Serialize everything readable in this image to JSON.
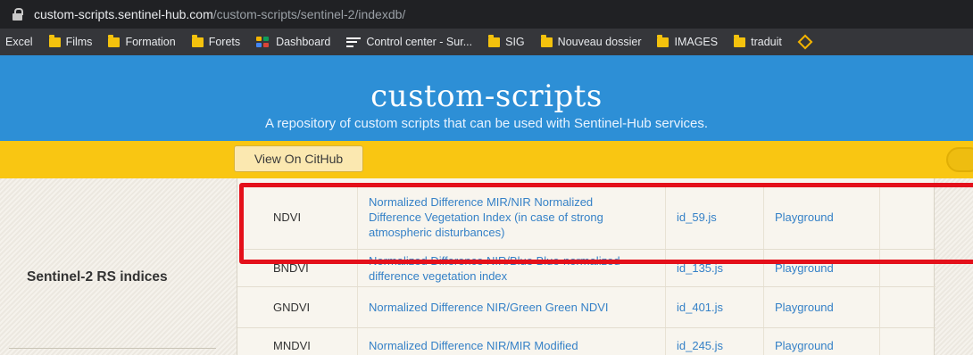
{
  "browser": {
    "url_host": "custom-scripts.sentinel-hub.com",
    "url_path": "/custom-scripts/sentinel-2/indexdb/",
    "bookmarks": [
      {
        "label": "Excel",
        "icon": "none"
      },
      {
        "label": "Films",
        "icon": "folder-icon"
      },
      {
        "label": "Formation",
        "icon": "folder-icon"
      },
      {
        "label": "Forets",
        "icon": "folder-icon"
      },
      {
        "label": "Dashboard",
        "icon": "dashboard-icon"
      },
      {
        "label": "Control center - Sur...",
        "icon": "control-center-icon"
      },
      {
        "label": "SIG",
        "icon": "folder-icon"
      },
      {
        "label": "Nouveau dossier",
        "icon": "folder-icon"
      },
      {
        "label": "IMAGES",
        "icon": "folder-icon"
      },
      {
        "label": "traduit",
        "icon": "folder-icon"
      }
    ]
  },
  "header": {
    "title": "custom-scripts",
    "subtitle": "A repository of custom scripts that can be used with Sentinel-Hub services."
  },
  "ribbon": {
    "github_button": "View On CitHub"
  },
  "section": {
    "title": "Sentinel-2 RS indices"
  },
  "table": {
    "rows": [
      {
        "name": "NDVI",
        "description": "Normalized Difference MIR/NIR Normalized Difference Vegetation Index (in case of strong atmospheric disturbances)",
        "script": "id_59.js",
        "link": "Playground"
      },
      {
        "name": "BNDVI",
        "description": "Normalized Difference NIR/Blue Blue-normalized difference vegetation index",
        "script": "id_135.js",
        "link": "Playground"
      },
      {
        "name": "GNDVI",
        "description": "Normalized Difference NIR/Green Green NDVI",
        "script": "id_401.js",
        "link": "Playground"
      },
      {
        "name": "MNDVI",
        "description": "Normalized Difference NIR/MIR Modified",
        "script": "id_245.js",
        "link": "Playground"
      }
    ]
  },
  "colors": {
    "header_blue": "#2d8fd6",
    "ribbon_yellow": "#f9c612",
    "link_blue": "#3581c7",
    "highlight_red": "#e4101a"
  }
}
